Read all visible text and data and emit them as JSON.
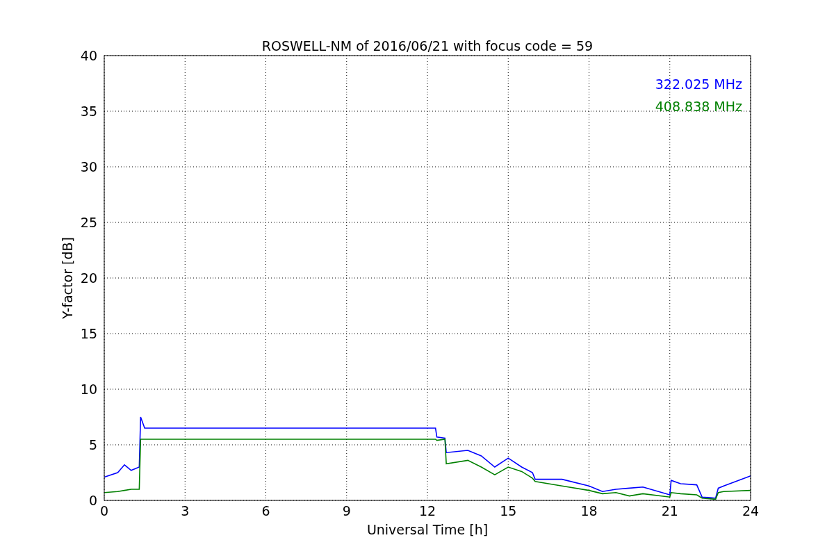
{
  "figure": {
    "chart_data": {
      "type": "line",
      "title": "ROSWELL-NM of 2016/06/21 with focus code = 59",
      "xlabel": "Universal Time [h]",
      "ylabel": "Y-factor [dB]",
      "x": [
        0,
        0.5,
        0.75,
        1,
        1.3,
        1.35,
        1.5,
        12.3,
        12.35,
        12.65,
        12.7,
        13.5,
        14,
        14.5,
        15,
        15.5,
        15.9,
        16,
        17,
        18,
        18.5,
        19,
        19.5,
        20,
        21,
        21.05,
        21.4,
        22,
        22.2,
        22.7,
        22.8,
        23,
        24
      ],
      "series": [
        {
          "name": "322.025 MHz",
          "color": "#0000ff",
          "values": [
            2.1,
            2.5,
            3.2,
            2.7,
            3.0,
            7.5,
            6.5,
            6.5,
            5.7,
            5.6,
            4.3,
            4.5,
            4.0,
            3.0,
            3.8,
            3.0,
            2.5,
            1.9,
            1.9,
            1.3,
            0.8,
            1.0,
            1.1,
            1.2,
            0.5,
            1.8,
            1.5,
            1.4,
            0.3,
            0.2,
            1.1,
            1.3,
            2.2
          ]
        },
        {
          "name": "408.838 MHz",
          "color": "#008000",
          "values": [
            0.7,
            0.8,
            0.9,
            1.0,
            1.0,
            5.5,
            5.5,
            5.5,
            5.4,
            5.5,
            3.3,
            3.6,
            3.0,
            2.3,
            3.0,
            2.6,
            2.0,
            1.7,
            1.3,
            0.9,
            0.6,
            0.7,
            0.4,
            0.6,
            0.3,
            0.7,
            0.6,
            0.5,
            0.2,
            0.1,
            0.7,
            0.8,
            0.9
          ]
        }
      ],
      "xlim": [
        0,
        24
      ],
      "ylim": [
        0,
        40
      ],
      "xticks": [
        0,
        3,
        6,
        9,
        12,
        15,
        18,
        21,
        24
      ],
      "yticks": [
        0,
        5,
        10,
        15,
        20,
        25,
        30,
        35,
        40
      ],
      "grid": true
    }
  }
}
